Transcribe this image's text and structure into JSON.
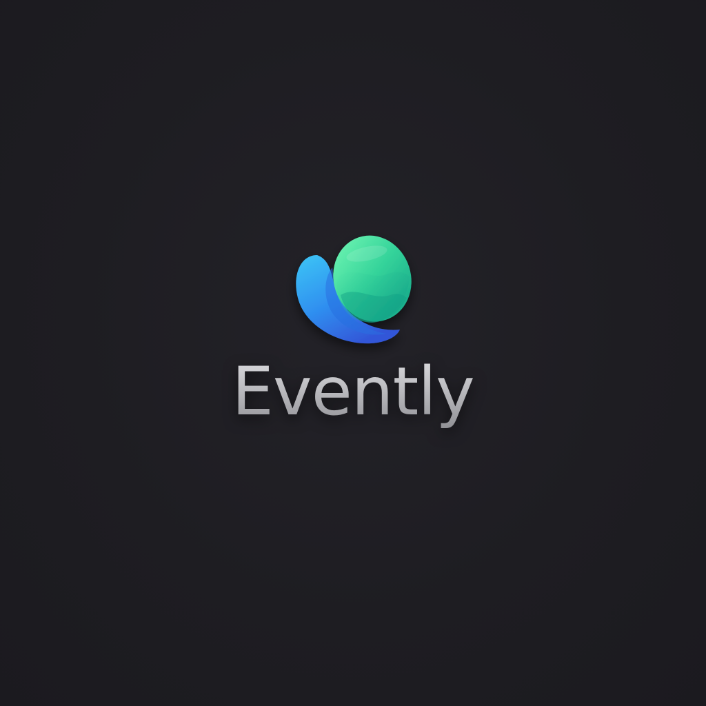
{
  "brand": {
    "name": "Evently",
    "logo_icon": "blue-green-orb-icon"
  },
  "colors": {
    "background": "#1e1d22",
    "logo_blue": "#2f8ff0",
    "logo_green": "#34d39a",
    "wordmark": "#b7b7bb"
  }
}
